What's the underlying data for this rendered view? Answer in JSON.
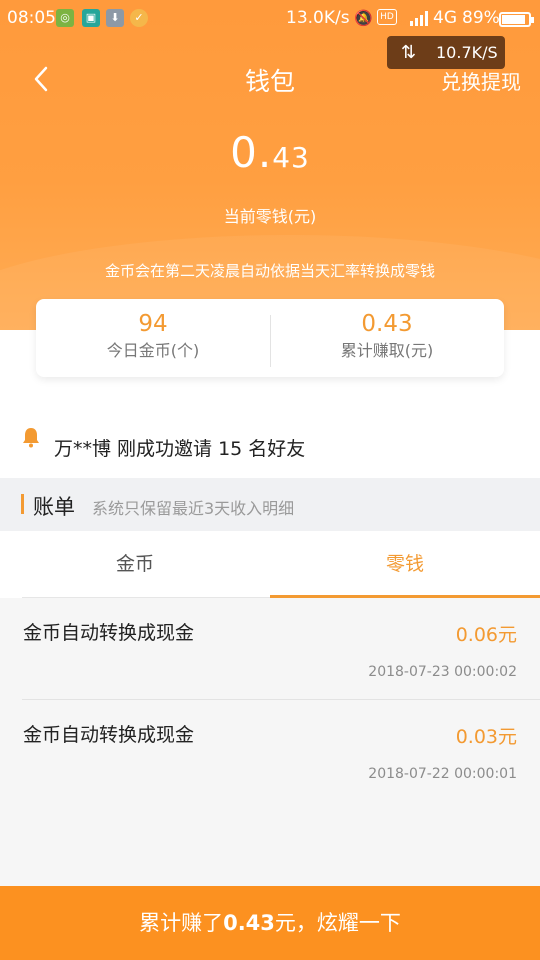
{
  "status_bar": {
    "time": "08:05",
    "net_speed": "13.0K/s",
    "network": "4G",
    "battery": "89%",
    "battery_level": 0.89,
    "icons": [
      "app-icon-1",
      "qr-icon",
      "download-icon",
      "app-icon-2",
      "mute-icon",
      "hd-icon",
      "signal-icon"
    ]
  },
  "speed_overlay": {
    "text": "10.7K/S"
  },
  "header": {
    "title": "钱包",
    "exchange_link": "兑换提现",
    "balance_int": "0.",
    "balance_dec": "43",
    "balance_label": "当前零钱(元)",
    "notice": "金币会在第二天凌晨自动依据当天汇率转换成零钱"
  },
  "stats": {
    "today_coins": "94",
    "today_coins_label": "今日金币(个)",
    "total_earned": "0.43",
    "total_earned_label": "累计赚取(元)"
  },
  "invite": {
    "text": "万**博 刚成功邀请 15 名好友"
  },
  "bill": {
    "title": "账单",
    "subtitle": "系统只保留最近3天收入明细"
  },
  "tabs": [
    {
      "label": "金币",
      "active": false
    },
    {
      "label": "零钱",
      "active": true
    }
  ],
  "records": [
    {
      "desc": "金币自动转换成现金",
      "amount": "0.06元",
      "time": "2018-07-23 00:00:02"
    },
    {
      "desc": "金币自动转换成现金",
      "amount": "0.03元",
      "time": "2018-07-22 00:00:01"
    }
  ],
  "cta": {
    "prefix": "累计赚了",
    "amount": "0.43",
    "suffix": "元，炫耀一下"
  },
  "colors": {
    "accent": "#f39a32",
    "header_bg": "#ff9f41",
    "cta_bg": "#fc9120"
  }
}
